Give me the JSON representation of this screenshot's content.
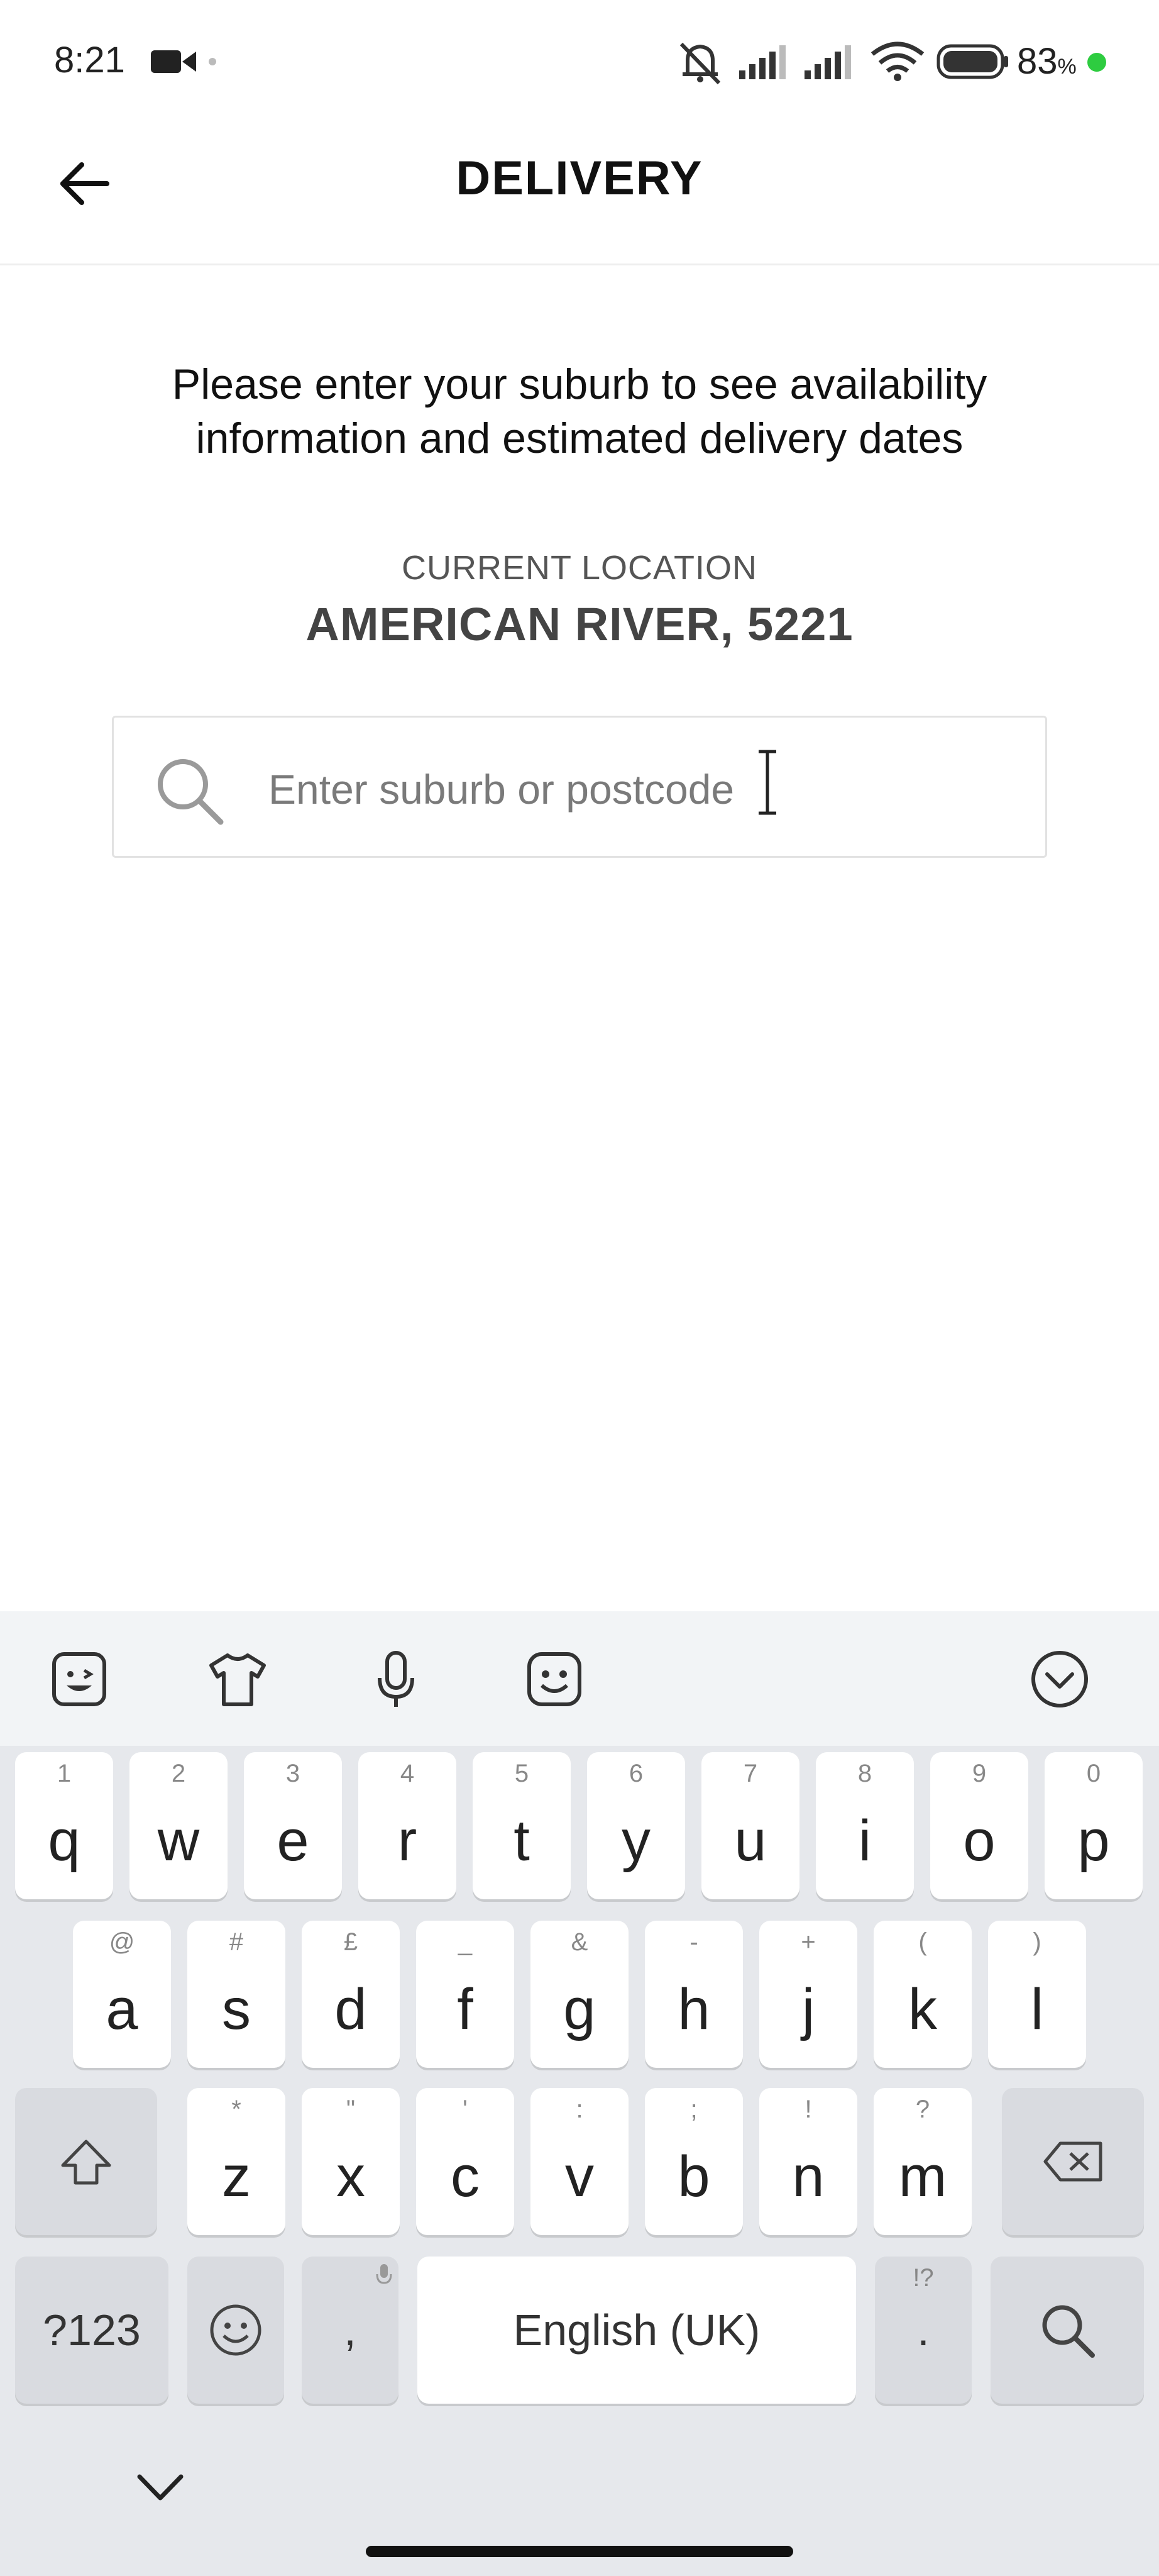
{
  "status_bar": {
    "time": "8:21",
    "battery_percent": "83",
    "battery_unit": "%"
  },
  "header": {
    "title": "DELIVERY",
    "back_icon": "arrow-left-icon"
  },
  "main": {
    "instructions_line1": "Please enter your suburb to see availability",
    "instructions_line2": "information and estimated delivery dates",
    "location_label": "CURRENT LOCATION",
    "location_value": "AMERICAN RIVER, 5221",
    "search": {
      "placeholder": "Enter suburb or postcode",
      "value": ""
    }
  },
  "keyboard": {
    "toolbar_icons": [
      "sticker-icon",
      "tshirt-icon",
      "microphone-icon",
      "emoji-face-icon",
      "chevron-down-circle-icon"
    ],
    "row1": [
      {
        "main": "q",
        "hint": "1"
      },
      {
        "main": "w",
        "hint": "2"
      },
      {
        "main": "e",
        "hint": "3"
      },
      {
        "main": "r",
        "hint": "4"
      },
      {
        "main": "t",
        "hint": "5"
      },
      {
        "main": "y",
        "hint": "6"
      },
      {
        "main": "u",
        "hint": "7"
      },
      {
        "main": "i",
        "hint": "8"
      },
      {
        "main": "o",
        "hint": "9"
      },
      {
        "main": "p",
        "hint": "0"
      }
    ],
    "row2": [
      {
        "main": "a",
        "hint": "@"
      },
      {
        "main": "s",
        "hint": "#"
      },
      {
        "main": "d",
        "hint": "£"
      },
      {
        "main": "f",
        "hint": "_"
      },
      {
        "main": "g",
        "hint": "&"
      },
      {
        "main": "h",
        "hint": "-"
      },
      {
        "main": "j",
        "hint": "+"
      },
      {
        "main": "k",
        "hint": "("
      },
      {
        "main": "l",
        "hint": ")"
      }
    ],
    "row3": [
      {
        "main": "z",
        "hint": "*"
      },
      {
        "main": "x",
        "hint": "\""
      },
      {
        "main": "c",
        "hint": "'"
      },
      {
        "main": "v",
        "hint": ":"
      },
      {
        "main": "b",
        "hint": ";"
      },
      {
        "main": "n",
        "hint": "!"
      },
      {
        "main": "m",
        "hint": "?"
      }
    ],
    "symbols_label": "?123",
    "comma_label": ",",
    "space_label": "English (UK)",
    "period_label": ".",
    "period_hint": "!?"
  }
}
